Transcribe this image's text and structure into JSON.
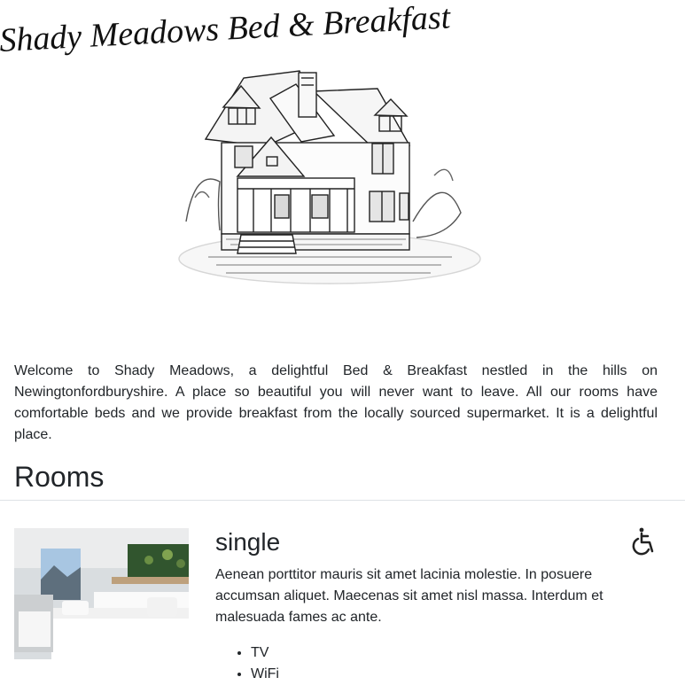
{
  "header": {
    "logo_text": "Shady Meadows Bed & Breakfast",
    "logo_image": "house-sketch-illustration"
  },
  "intro": {
    "text": "Welcome to Shady Meadows, a delightful Bed & Breakfast nestled in the hills on Newingtonfordburyshire. A place so beautiful you will never want to leave. All our rooms have comfortable beds and we provide breakfast from the locally sourced supermarket. It is a delightful place."
  },
  "rooms": {
    "heading": "Rooms",
    "items": [
      {
        "type": "single",
        "image": "hotel-room-photo",
        "accessibility_icon": "wheelchair-icon",
        "description": "Aenean porttitor mauris sit amet lacinia molestie. In posuere accumsan aliquet. Maecenas sit amet nisl massa. Interdum et malesuada fames ac ante.",
        "features": [
          "TV",
          "WiFi"
        ]
      }
    ]
  }
}
